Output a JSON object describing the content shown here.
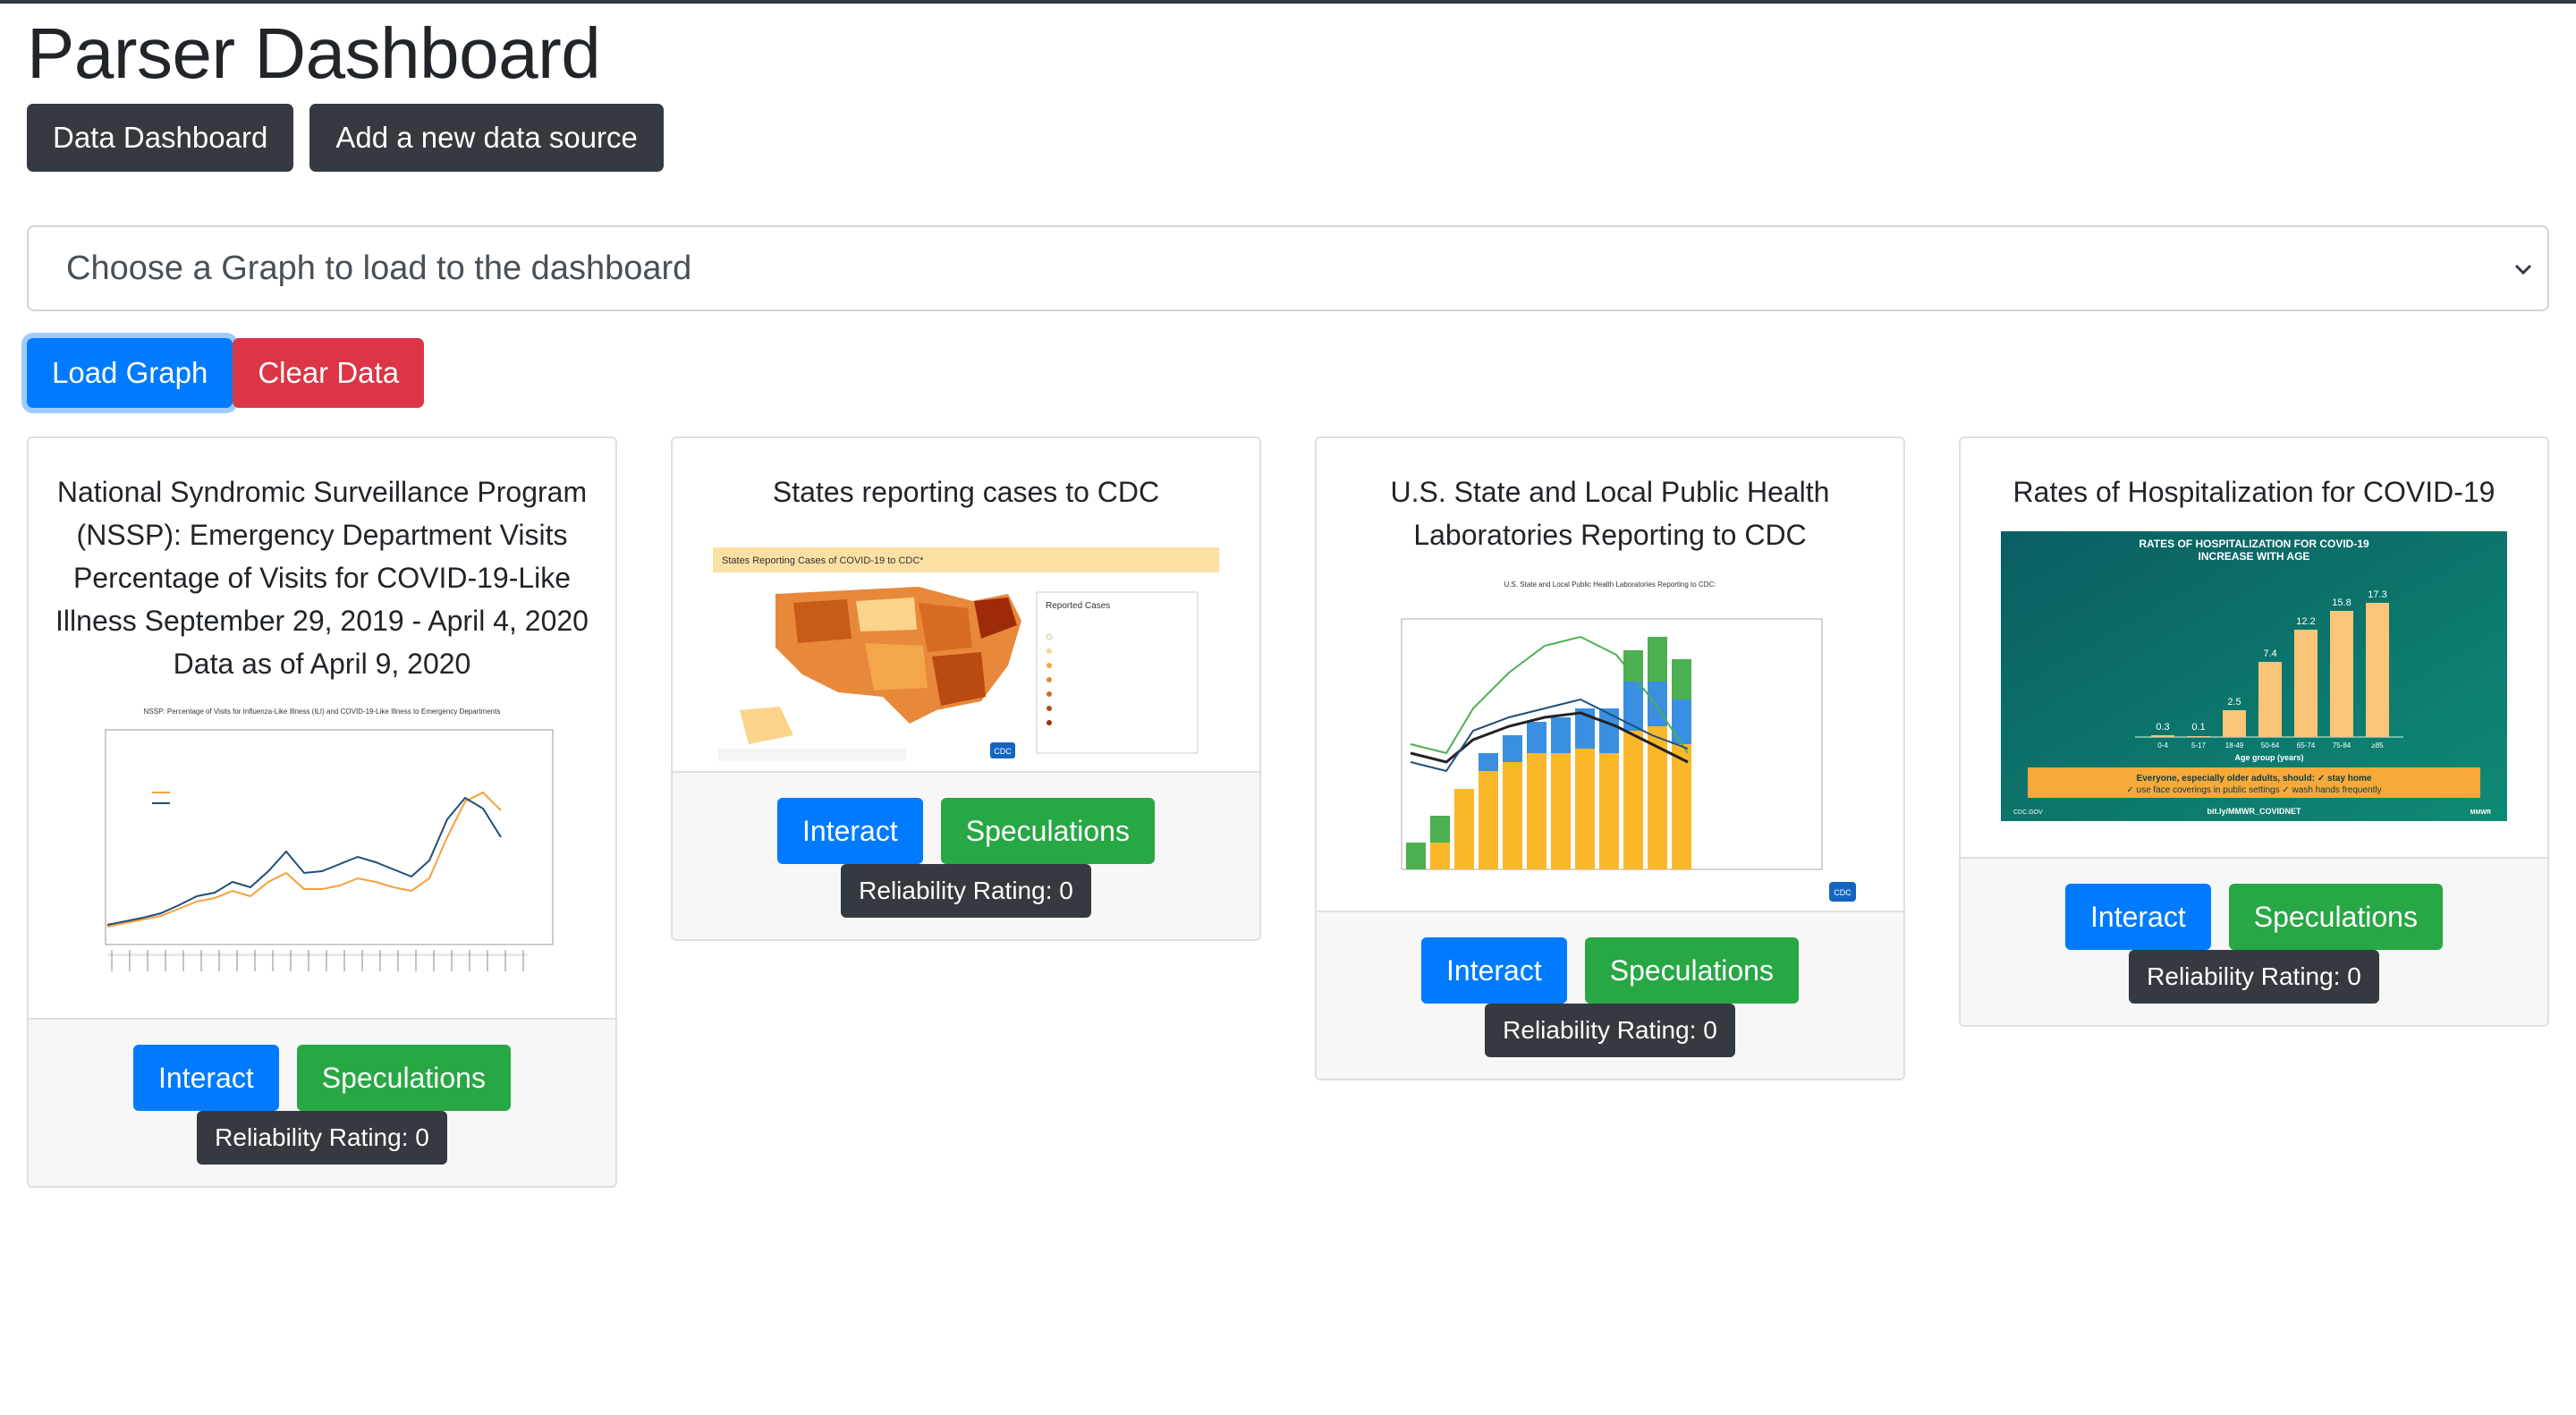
{
  "header": {
    "title": "Parser Dashboard"
  },
  "nav": {
    "data_dashboard": "Data Dashboard",
    "add_source": "Add a new data source"
  },
  "graph_select": {
    "selected": "Choose a Graph to load to the dashboard"
  },
  "actions": {
    "load": "Load Graph",
    "clear": "Clear Data"
  },
  "cards": [
    {
      "title": "National Syndromic Surveillance Program (NSSP): Emergency Department Visits Percentage of Visits for COVID-19-Like Illness September 29, 2019 - April 4, 2020 Data as of April 9, 2020",
      "interact": "Interact",
      "speculations": "Speculations",
      "rating": "Reliability Rating: 0",
      "image_caption": "NSSP: Percentage of Visits for Influenza-Like Illness (ILI) and COVID-19-Like Illness to Emergency Departments"
    },
    {
      "title": "States reporting cases to CDC",
      "interact": "Interact",
      "speculations": "Speculations",
      "rating": "Reliability Rating: 0",
      "image_caption": "States Reporting Cases of COVID-19 to CDC*",
      "legend_title": "Reported Cases",
      "logo": "CDC"
    },
    {
      "title": "U.S. State and Local Public Health Laboratories Reporting to CDC",
      "interact": "Interact",
      "speculations": "Speculations",
      "rating": "Reliability Rating: 0",
      "image_caption": "U.S. State and Local Public Health Laboratories Reporting to CDC:",
      "logo": "CDC"
    },
    {
      "title": "Rates of Hospitalization for COVID-19",
      "interact": "Interact",
      "speculations": "Speculations",
      "rating": "Reliability Rating: 0",
      "infographic": {
        "heading1": "RATES OF HOSPITALIZATION FOR COVID-19",
        "heading2": "INCREASE WITH AGE",
        "bar_values": [
          "0.3",
          "0.1",
          "2.5",
          "7.4",
          "12.2",
          "15.8",
          "17.3"
        ],
        "bar_labels": [
          "0-4",
          "5-17",
          "18-49",
          "50-64",
          "65-74",
          "75-84",
          "≥85"
        ],
        "axis_label": "Age group (years)",
        "message1": "Everyone, especially older adults, should: ✓ stay home",
        "message2": "✓ use face coverings in public settings ✓ wash hands frequently",
        "footer_left": "CDC.GOV",
        "footer_center": "bit.ly/MMWR_COVIDNET",
        "footer_right": "MMWR"
      }
    }
  ],
  "colors": {
    "primary": "#007bff",
    "success": "#28a745",
    "danger": "#dc3545",
    "dark": "#343a40"
  }
}
